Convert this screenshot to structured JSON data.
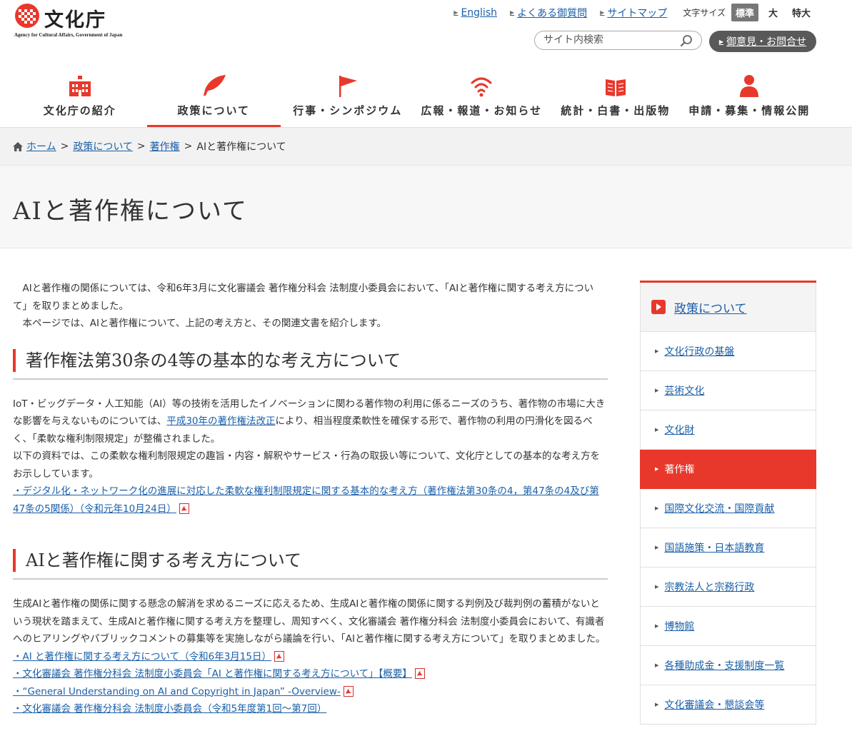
{
  "header": {
    "logo_text": "文化庁",
    "logo_sub": "Agency for Cultural Affairs, Government of Japan",
    "utility_links": [
      {
        "label": "English"
      },
      {
        "label": "よくある御質問"
      },
      {
        "label": "サイトマップ"
      }
    ],
    "font_size_label": "文字サイズ",
    "font_sizes": [
      "標準",
      "大",
      "特大"
    ],
    "search_placeholder": "サイト内検索",
    "contact_label": "御意見・お問合せ"
  },
  "gnav": [
    {
      "label": "文化庁の紹介",
      "icon": "building-icon"
    },
    {
      "label": "政策について",
      "icon": "feather-pen-icon",
      "active": true
    },
    {
      "label": "行事・シンポジウム",
      "icon": "flag-icon"
    },
    {
      "label": "広報・報道・お知らせ",
      "icon": "broadcast-icon"
    },
    {
      "label": "統計・白書・出版物",
      "icon": "book-icon"
    },
    {
      "label": "申請・募集・情報公開",
      "icon": "person-icon"
    }
  ],
  "breadcrumb": {
    "home": "ホーム",
    "items": [
      "政策について",
      "著作権"
    ],
    "current": "AIと著作権について",
    "sep": ">"
  },
  "page_title": "AIと著作権について",
  "intro": [
    "AIと著作権の関係については、令和6年3月に文化審議会 著作権分科会 法制度小委員会において、「AIと著作権に関する考え方について」を取りまとめました。",
    "本ページでは、AIと著作権について、上記の考え方と、その関連文書を紹介します。"
  ],
  "section1": {
    "heading": "著作権法第30条の4等の基本的な考え方について",
    "p1_before": "IoT・ビッグデータ・人工知能（AI）等の技術を活用したイノベーションに関わる著作物の利用に係るニーズのうち、著作物の市場に大きな影響を与えないものについては、",
    "p1_link": "平成30年の著作権法改正",
    "p1_after": "により、相当程度柔軟性を確保する形で、著作物の利用の円滑化を図るべく、「柔軟な権利制限規定」が整備されました。",
    "p2": "以下の資料では、この柔軟な権利制限規定の趣旨・内容・解釈やサービス・行為の取扱い等について、文化庁としての基本的な考え方をお示ししています。",
    "links": [
      {
        "label": "・デジタル化・ネットワーク化の進展に対応した柔軟な権利制限規定に関する基本的な考え方（著作権法第30条の4，第47条の4及び第47条の5関係）（令和元年10月24日）",
        "pdf": true
      }
    ]
  },
  "section2": {
    "heading": "AIと著作権に関する考え方について",
    "p1": "生成AIと著作権の関係に関する懸念の解消を求めるニーズに応えるため、生成AIと著作権の関係に関する判例及び裁判例の蓄積がないという現状を踏まえて、生成AIと著作権に関する考え方を整理し、周知すべく、文化審議会 著作権分科会 法制度小委員会において、有識者へのヒアリングやパブリックコメントの募集等を実施しながら議論を行い、「AIと著作権に関する考え方について」を取りまとめました。",
    "links": [
      {
        "label": "・AI と著作権に関する考え方について（令和6年3月15日）",
        "pdf": true
      },
      {
        "label": "・文化審議会 著作権分科会 法制度小委員会「AI と著作権に関する考え方について」【概要】",
        "pdf": true
      },
      {
        "label": "・“General Understanding on AI and Copyright in Japan” -Overview-",
        "pdf": true
      },
      {
        "label": "・文化審議会 著作権分科会 法制度小委員会（令和5年度第1回～第7回）",
        "pdf": false
      }
    ]
  },
  "sidebar": {
    "heading": "政策について",
    "items": [
      {
        "label": "文化行政の基盤"
      },
      {
        "label": "芸術文化"
      },
      {
        "label": "文化財"
      },
      {
        "label": "著作権",
        "active": true
      },
      {
        "label": "国際文化交流・国際貢献"
      },
      {
        "label": "国語施策・日本語教育"
      },
      {
        "label": "宗教法人と宗務行政"
      },
      {
        "label": "博物館"
      },
      {
        "label": "各種助成金・支援制度一覧"
      },
      {
        "label": "文化審議会・懇談会等"
      }
    ]
  },
  "colors": {
    "accent": "#e8382c",
    "link": "#1a5fa8"
  }
}
